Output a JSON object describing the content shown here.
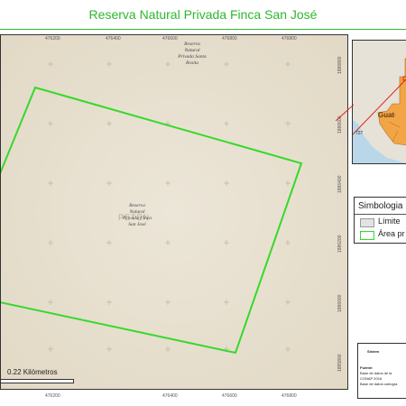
{
  "title": "Reserva Natural Privada Finca San José",
  "map": {
    "x_ticks_top": [
      "476200",
      "476400",
      "476600",
      "476800"
    ],
    "x_ticks_bottom": [
      "476200",
      "476400",
      "476600",
      "476800"
    ],
    "y_ticks_right": [
      "1886800",
      "1886600",
      "1886400",
      "1886200",
      "1886000",
      "1885800"
    ],
    "labels": {
      "santa_rosita": [
        "Reserva",
        "Natural",
        "Privada Santa",
        "Rosita"
      ],
      "san_jose": [
        "Reserva",
        "Natural",
        "Privada Finca",
        "San José"
      ],
      "region": "PETÉN"
    },
    "scale_text": "0.22 Kilómetros",
    "polygon_color": "#35d92a"
  },
  "inset": {
    "region_label": "Guat",
    "left_label": "727"
  },
  "legend": {
    "title": "Simbologia",
    "items": [
      {
        "label": "Límite",
        "swatch_fill": "#e3e3e3",
        "swatch_stroke": "#999999"
      },
      {
        "label": "Área pr",
        "swatch_fill": "#ffffff",
        "swatch_stroke": "#35d92a"
      }
    ]
  },
  "info": {
    "title": "Sistem",
    "lines": [
      "Fuente:",
      "Base de datos de la",
      "CONAP 2016",
      "Base de datos cartogra"
    ]
  }
}
